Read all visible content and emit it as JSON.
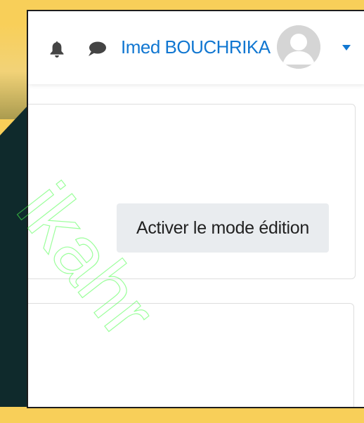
{
  "navbar": {
    "notifications_icon": "bell-icon",
    "messages_icon": "chat-bubble-icon",
    "user_name": "Imed BOUCHRIKA",
    "avatar_icon": "user-avatar-icon",
    "menu_icon": "caret-down-icon"
  },
  "main": {
    "edit_mode_button": "Activer le mode édition"
  },
  "colors": {
    "frame": "#f8cf59",
    "link": "#1177d1",
    "button_bg": "#e9ecef",
    "watermark": "#4cff4c"
  },
  "watermark": {
    "text": "ikahr"
  }
}
